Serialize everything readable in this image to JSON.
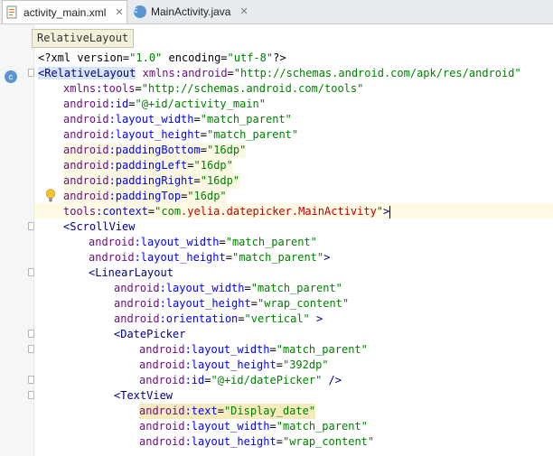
{
  "tabs": [
    {
      "label": "activity_main.xml",
      "active": true,
      "icon": "xml-file-icon"
    },
    {
      "label": "MainActivity.java",
      "active": false,
      "icon": "java-class-icon"
    }
  ],
  "breadcrumb": "RelativeLayout",
  "gutter_icon_glyph": "c",
  "code": {
    "l1": {
      "a": "<?xml version=",
      "b": "\"1.0\"",
      "c": " encoding=",
      "d": "\"utf-8\"",
      "e": "?>"
    },
    "l2": {
      "tag": "<RelativeLayout",
      "ns": " xmlns",
      "sep": ":",
      "attr": "android",
      "eq": "=",
      "val": "\"http://schemas.android.com/apk/res/android\""
    },
    "l3": {
      "ns": "xmlns",
      "sep": ":",
      "attr": "tools",
      "eq": "=",
      "val": "\"http://schemas.android.com/tools\""
    },
    "l4": {
      "ns": "android",
      "attr": ":id",
      "eq": "=",
      "val": "\"@+id/activity_main\""
    },
    "l5": {
      "ns": "android",
      "attr": ":layout_width",
      "eq": "=",
      "val": "\"match_parent\""
    },
    "l6": {
      "ns": "android",
      "attr": ":layout_height",
      "eq": "=",
      "val": "\"match_parent\""
    },
    "l7": {
      "ns": "android",
      "attr": ":paddingBottom",
      "eq": "=",
      "val": "\"16dp\""
    },
    "l8": {
      "ns": "android",
      "attr": ":paddingLeft",
      "eq": "=",
      "val": "\"16dp\""
    },
    "l9": {
      "ns": "android",
      "attr": ":paddingRight",
      "eq": "=",
      "val": "\"16dp\""
    },
    "l10": {
      "ns": "android",
      "attr": ":paddingTop",
      "eq": "=",
      "val": "\"16dp\""
    },
    "l11": {
      "ns": "tools",
      "attr": ":context",
      "eq": "=",
      "q1": "\"com.",
      "ref": "yelia.datepicker.MainActivity",
      "q2": "\"",
      "end": ">"
    },
    "l12": {
      "tag": "<ScrollView"
    },
    "l13": {
      "ns": "android",
      "attr": ":layout_width",
      "eq": "=",
      "val": "\"match_parent\""
    },
    "l14": {
      "ns": "android",
      "attr": ":layout_height",
      "eq": "=",
      "val": "\"match_parent\"",
      "end": ">"
    },
    "l15": {
      "tag": "<LinearLayout"
    },
    "l16": {
      "ns": "android",
      "attr": ":layout_width",
      "eq": "=",
      "val": "\"match_parent\""
    },
    "l17": {
      "ns": "android",
      "attr": ":layout_height",
      "eq": "=",
      "val": "\"wrap_content\""
    },
    "l18": {
      "ns": "android",
      "attr": ":orientation",
      "eq": "=",
      "val": "\"vertical\"",
      "end": " >"
    },
    "l19": {
      "tag": "<DatePicker"
    },
    "l20": {
      "ns": "android",
      "attr": ":layout_width",
      "eq": "=",
      "val": "\"match_parent\""
    },
    "l21": {
      "ns": "android",
      "attr": ":layout_height",
      "eq": "=",
      "val": "\"392dp\""
    },
    "l22": {
      "ns": "android",
      "attr": ":id",
      "eq": "=",
      "val": "\"@+id/datePicker\"",
      "end": " />"
    },
    "l23": {
      "tag": "<TextView"
    },
    "l24": {
      "ns": "android",
      "attr": ":text",
      "eq": "=",
      "val": "\"Display_date\""
    },
    "l25": {
      "ns": "android",
      "attr": ":layout_width",
      "eq": "=",
      "val": "\"match_parent\""
    },
    "l26": {
      "ns": "android",
      "attr": ":layout_height",
      "eq": "=",
      "val": "\"wrap_content\""
    }
  }
}
